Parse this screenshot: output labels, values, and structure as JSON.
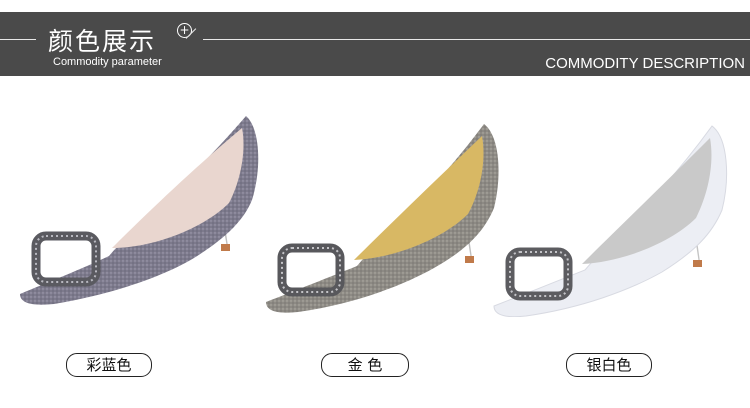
{
  "header": {
    "title": "颜色展示",
    "subtitle": "Commodity parameter",
    "description": "COMMODITY DESCRIPTION"
  },
  "products": [
    {
      "color_label": "彩蓝色",
      "shoe_color": "#7d7a8c",
      "lining": "#e9d6cf"
    },
    {
      "color_label": "金  色",
      "shoe_color": "#8d8a84",
      "lining": "#d8b864"
    },
    {
      "color_label": "银白色",
      "shoe_color": "#eceef4",
      "lining": "#c9c9c9"
    }
  ]
}
